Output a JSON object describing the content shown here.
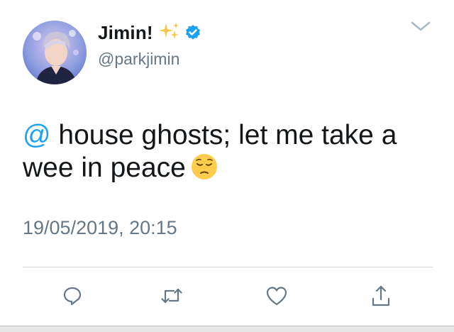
{
  "user": {
    "display_name": "Jimin!",
    "handle": "@parkjimin",
    "verified": true,
    "name_emoji": "sparkles",
    "avatar": "profile-photo"
  },
  "tweet": {
    "mention": "@",
    "text": " house ghosts; let me take a wee in peace",
    "emoji": "pensive-face",
    "timestamp": "19/05/2019, 20:15"
  },
  "actions": [
    "reply-icon",
    "retweet-icon",
    "like-icon",
    "share-icon"
  ],
  "colors": {
    "accent": "#1da1f2",
    "secondary_text": "#657786",
    "icon": "#657786",
    "divider": "#d0d6db"
  }
}
